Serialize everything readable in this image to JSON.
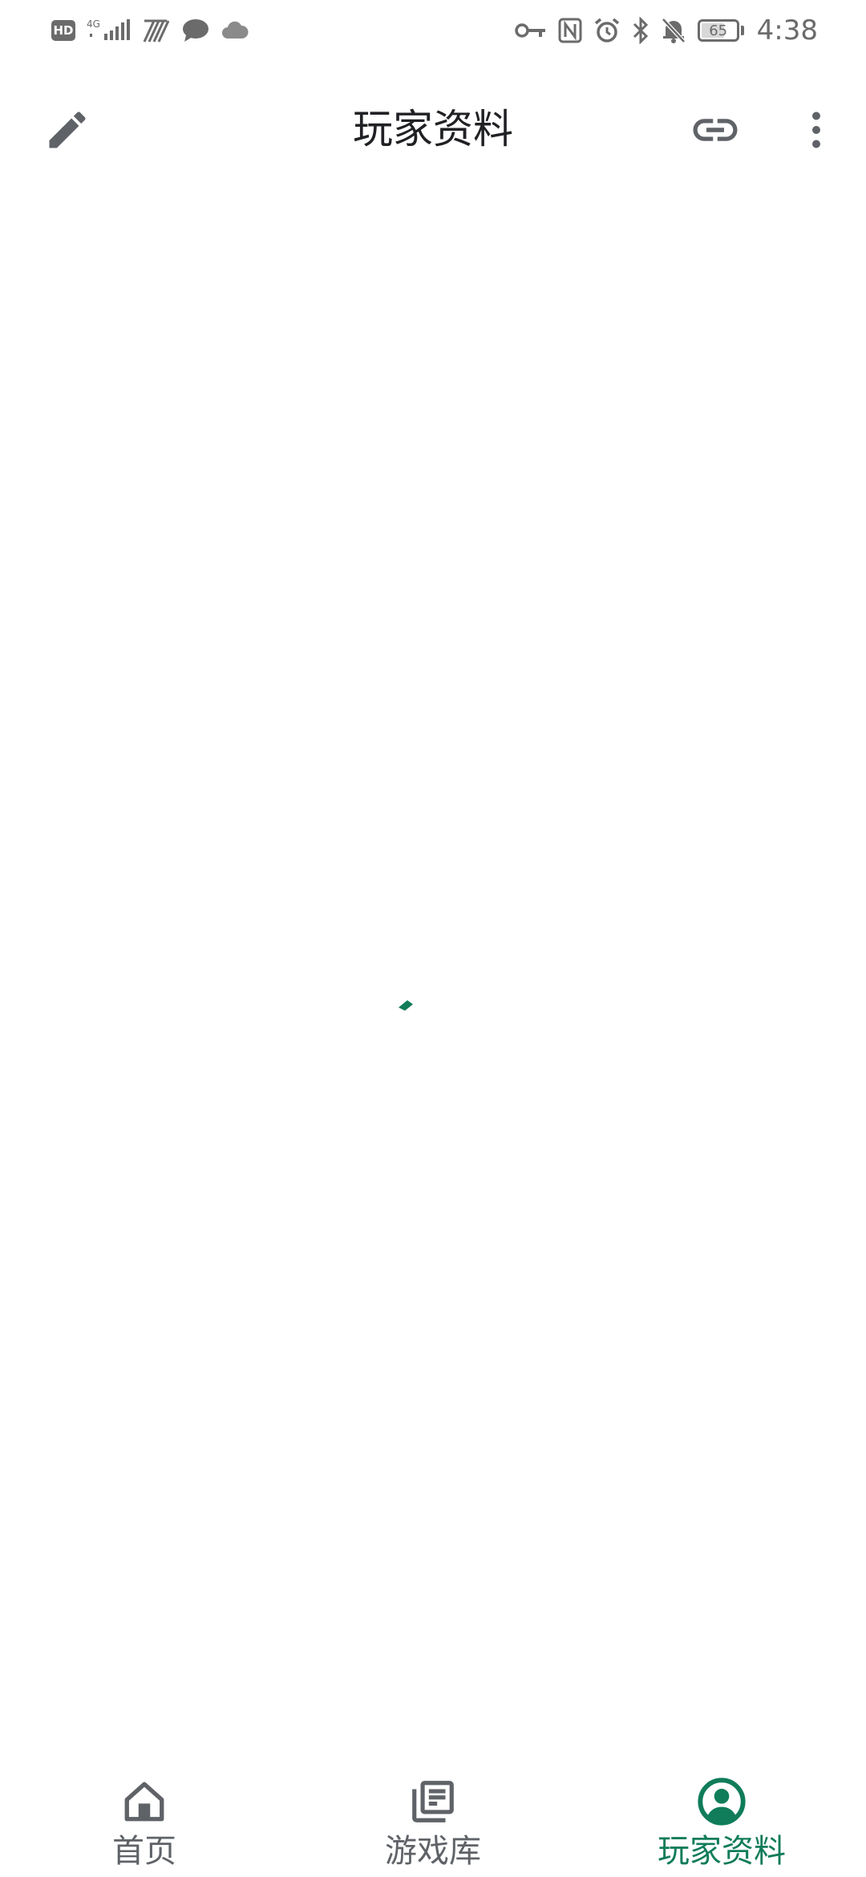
{
  "status_bar": {
    "left_icons": [
      "hd-badge",
      "signal-4g-icon",
      "wifi-icon",
      "message-icon",
      "cloud-icon"
    ],
    "hd_label": "HD",
    "network_label": "4G",
    "right_icons": [
      "key-icon",
      "nfc-icon",
      "alarm-icon",
      "bluetooth-icon",
      "bell-off-icon",
      "battery-icon"
    ],
    "battery_level": "65",
    "time": "4:38"
  },
  "app_bar": {
    "title": "玩家资料",
    "left_action_icon": "pencil-icon",
    "right_action_icons": [
      "link-icon",
      "more-vertical-icon"
    ]
  },
  "content": {
    "state": "loading",
    "spinner_icon": "loading-spinner-icon"
  },
  "bottom_nav": {
    "items": [
      {
        "label": "首页",
        "icon": "home-icon",
        "active": false
      },
      {
        "label": "游戏库",
        "icon": "library-icon",
        "active": false
      },
      {
        "label": "玩家资料",
        "icon": "account-circle-icon",
        "active": true
      }
    ]
  },
  "colors": {
    "accent": "#107c5a",
    "icon_gray": "#5f6368",
    "status_gray": "#6b6b6b",
    "background": "#ffffff"
  }
}
